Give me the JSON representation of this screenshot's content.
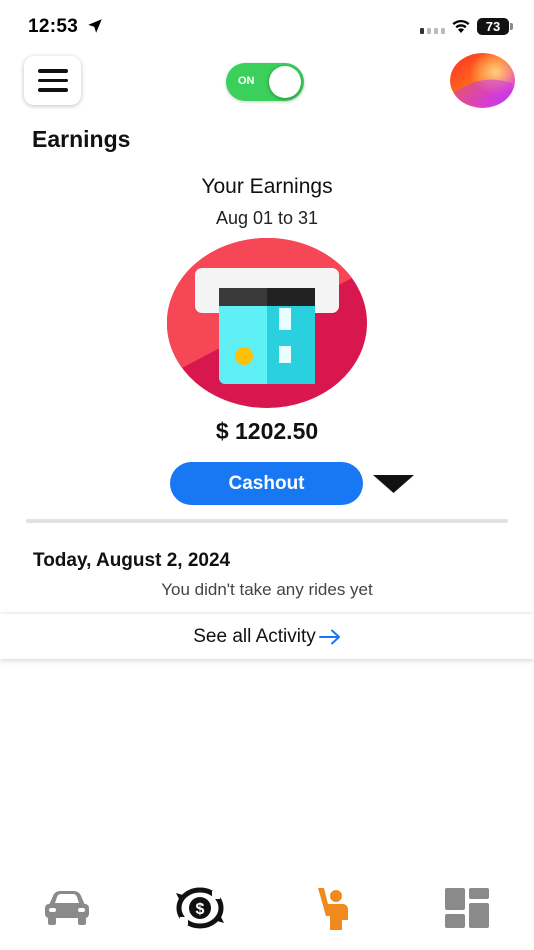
{
  "status_bar": {
    "time": "12:53",
    "battery": "73",
    "icons": [
      "location-arrow-icon",
      "signal-icon",
      "wifi-icon",
      "battery-icon"
    ]
  },
  "header": {
    "menu_icon": "hamburger-menu-icon",
    "online_toggle": {
      "label": "ON",
      "state": "on",
      "color": "#3bd05c"
    },
    "avatar": "profile-avatar"
  },
  "page": {
    "title": "Earnings"
  },
  "earnings": {
    "heading": "Your Earnings",
    "range": "Aug 01 to 31",
    "illustration": "card-payment-icon",
    "amount": "$ 1202.50",
    "cashout_label": "Cashout",
    "cashout_color": "#1877f2",
    "dropdown_icon": "caret-down-icon"
  },
  "activity": {
    "date_heading": "Today, August 2, 2024",
    "empty_message": "You didn't take any rides yet",
    "see_all_label": "See all Activity",
    "see_all_icon": "arrow-right-icon",
    "link_color": "#1877f2"
  },
  "tab_bar": {
    "tabs": [
      {
        "name": "car-icon",
        "color": "#8a8a8a"
      },
      {
        "name": "dollar-cycle-icon",
        "color": "#111111"
      },
      {
        "name": "rider-hail-icon",
        "color": "#f08a1c"
      },
      {
        "name": "dashboard-icon",
        "color": "#8a8a8a"
      }
    ]
  }
}
